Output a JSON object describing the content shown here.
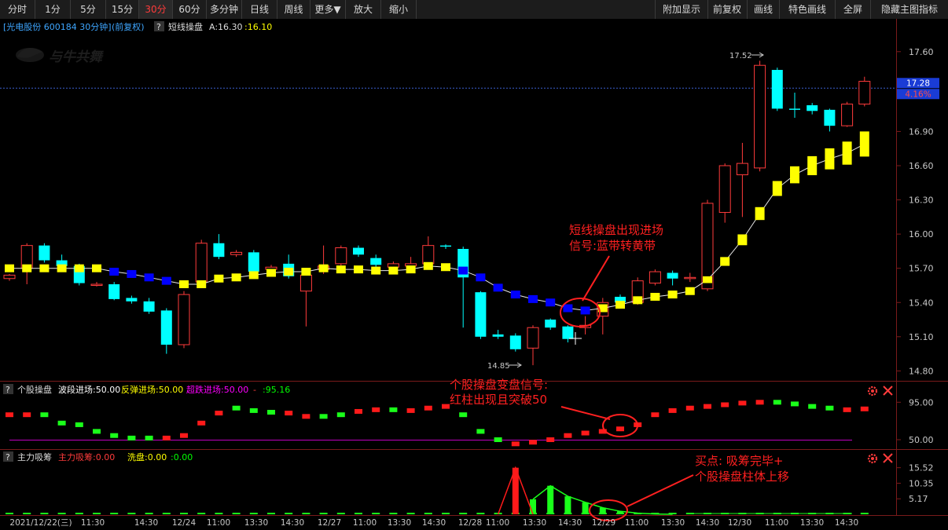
{
  "toolbar": {
    "left_buttons": [
      "分时",
      "1分",
      "5分",
      "15分",
      "30分",
      "60分",
      "多分钟",
      "日线",
      "周线",
      "更多▼",
      "放大",
      "缩小"
    ],
    "active_index": 4,
    "right_buttons": [
      "附加显示",
      "前复权",
      "画线",
      "特色画线",
      "全屏",
      "隐藏主图指标"
    ]
  },
  "main": {
    "title_stock": "[光电股份 600184 30分钟]",
    "title_fq": "(前复权)",
    "help_icon": "?",
    "indicator_name": "短线操盘",
    "indicator_a": "A:16.30",
    "indicator_b": ":16.10",
    "watermark": "与牛共舞",
    "price_ticks": [
      "17.60",
      "16.90",
      "16.60",
      "16.30",
      "16.00",
      "15.70",
      "15.40",
      "15.10",
      "14.80"
    ],
    "price_range": [
      14.72,
      17.75
    ],
    "current_price": "17.28",
    "current_pct": "4.16%",
    "high_label": "17.52",
    "low_label": "14.85",
    "annotation_line1": "短线操盘出现进场",
    "annotation_line2": "信号:蓝带转黄带"
  },
  "sub1": {
    "help_icon": "?",
    "name": "个股操盘",
    "label1": "波段进场:50.00",
    "label2": "反弹进场:50.00",
    "label3": "超跌进场:50.00",
    "label4": "-",
    "label5": ":95.16",
    "ticks": [
      "95.00",
      "50.00"
    ],
    "annotation_line1": "个股操盘变盘信号:",
    "annotation_line2": "红柱出现且突破50"
  },
  "sub2": {
    "help_icon": "?",
    "name": "主力吸筹",
    "label1": "主力吸筹:0.00",
    "label2": "洗盘:0.00",
    "label3": ":0.00",
    "ticks": [
      "15.52",
      "10.35",
      "5.17"
    ],
    "annotation_line1": "买点: 吸筹完毕+",
    "annotation_line2": "个股操盘柱体上移"
  },
  "time_axis": [
    "2021/12/22(三)",
    "11:30",
    "14:30",
    "12/24",
    "11:00",
    "13:30",
    "14:30",
    "12/27",
    "11:00",
    "13:30",
    "14:30",
    "12/28",
    "11:00",
    "13:30",
    "14:30",
    "12/29",
    "11:00",
    "13:30",
    "14:30",
    "12/30",
    "11:00",
    "13:30",
    "14:30"
  ],
  "colors": {
    "up": "#ff3b3b",
    "down": "#00ffff",
    "band_blue": "#0000ff",
    "band_yellow": "#ffff00",
    "annotation": "#ff2020",
    "accent_blue": "#1e90ff"
  },
  "chart_data": {
    "type": "candlestick",
    "candles": [
      {
        "o": 15.61,
        "c": 15.64,
        "h": 15.65,
        "l": 15.59,
        "up": true
      },
      {
        "o": 15.7,
        "c": 15.9,
        "h": 15.92,
        "l": 15.56,
        "up": true
      },
      {
        "o": 15.9,
        "c": 15.77,
        "h": 15.92,
        "l": 15.75,
        "up": false
      },
      {
        "o": 15.77,
        "c": 15.72,
        "h": 15.82,
        "l": 15.7,
        "up": false
      },
      {
        "o": 15.72,
        "c": 15.57,
        "h": 15.74,
        "l": 15.55,
        "up": false
      },
      {
        "o": 15.56,
        "c": 15.55,
        "h": 15.58,
        "l": 15.54,
        "up": true
      },
      {
        "o": 15.56,
        "c": 15.43,
        "h": 15.58,
        "l": 15.42,
        "up": false
      },
      {
        "o": 15.44,
        "c": 15.41,
        "h": 15.46,
        "l": 15.39,
        "up": false
      },
      {
        "o": 15.41,
        "c": 15.32,
        "h": 15.44,
        "l": 15.3,
        "up": false
      },
      {
        "o": 15.33,
        "c": 15.03,
        "h": 15.35,
        "l": 14.95,
        "up": false
      },
      {
        "o": 15.03,
        "c": 15.47,
        "h": 15.5,
        "l": 15.0,
        "up": true
      },
      {
        "o": 15.58,
        "c": 15.92,
        "h": 15.95,
        "l": 15.56,
        "up": true
      },
      {
        "o": 15.92,
        "c": 15.8,
        "h": 16.0,
        "l": 15.78,
        "up": false
      },
      {
        "o": 15.82,
        "c": 15.84,
        "h": 15.86,
        "l": 15.8,
        "up": true
      },
      {
        "o": 15.84,
        "c": 15.67,
        "h": 15.86,
        "l": 15.65,
        "up": false
      },
      {
        "o": 15.69,
        "c": 15.71,
        "h": 15.73,
        "l": 15.67,
        "up": true
      },
      {
        "o": 15.74,
        "c": 15.63,
        "h": 15.82,
        "l": 15.61,
        "up": false
      },
      {
        "o": 15.5,
        "c": 15.64,
        "h": 15.7,
        "l": 15.19,
        "up": true
      },
      {
        "o": 15.69,
        "c": 15.72,
        "h": 15.9,
        "l": 15.65,
        "up": true
      },
      {
        "o": 15.74,
        "c": 15.88,
        "h": 15.9,
        "l": 15.7,
        "up": true
      },
      {
        "o": 15.88,
        "c": 15.82,
        "h": 15.9,
        "l": 15.8,
        "up": false
      },
      {
        "o": 15.79,
        "c": 15.73,
        "h": 15.82,
        "l": 15.71,
        "up": false
      },
      {
        "o": 15.71,
        "c": 15.74,
        "h": 15.76,
        "l": 15.69,
        "up": true
      },
      {
        "o": 15.72,
        "c": 15.74,
        "h": 15.8,
        "l": 15.7,
        "up": true
      },
      {
        "o": 15.74,
        "c": 15.9,
        "h": 15.98,
        "l": 15.72,
        "up": true
      },
      {
        "o": 15.9,
        "c": 15.89,
        "h": 15.91,
        "l": 15.87,
        "up": false
      },
      {
        "o": 15.87,
        "c": 15.62,
        "h": 15.89,
        "l": 15.18,
        "up": false
      },
      {
        "o": 15.49,
        "c": 15.1,
        "h": 15.5,
        "l": 15.08,
        "up": false
      },
      {
        "o": 15.12,
        "c": 15.1,
        "h": 15.16,
        "l": 15.08,
        "up": false
      },
      {
        "o": 15.11,
        "c": 14.99,
        "h": 15.13,
        "l": 14.97,
        "up": false
      },
      {
        "o": 15.0,
        "c": 15.18,
        "h": 15.2,
        "l": 14.85,
        "up": true
      },
      {
        "o": 15.25,
        "c": 15.18,
        "h": 15.26,
        "l": 15.16,
        "up": false
      },
      {
        "o": 15.19,
        "c": 15.08,
        "h": 15.2,
        "l": 15.05,
        "up": false
      },
      {
        "o": 15.18,
        "c": 15.2,
        "h": 15.28,
        "l": 15.12,
        "up": true
      },
      {
        "o": 15.28,
        "c": 15.4,
        "h": 15.44,
        "l": 15.12,
        "up": true
      },
      {
        "o": 15.4,
        "c": 15.45,
        "h": 15.47,
        "l": 15.38,
        "up": false
      },
      {
        "o": 15.4,
        "c": 15.59,
        "h": 15.62,
        "l": 15.38,
        "up": true
      },
      {
        "o": 15.57,
        "c": 15.67,
        "h": 15.69,
        "l": 15.55,
        "up": true
      },
      {
        "o": 15.66,
        "c": 15.61,
        "h": 15.68,
        "l": 15.55,
        "up": false
      },
      {
        "o": 15.62,
        "c": 15.62,
        "h": 15.66,
        "l": 15.58,
        "up": true
      },
      {
        "o": 15.52,
        "c": 16.27,
        "h": 16.3,
        "l": 15.5,
        "up": true
      },
      {
        "o": 16.19,
        "c": 16.6,
        "h": 16.62,
        "l": 16.1,
        "up": true
      },
      {
        "o": 16.52,
        "c": 16.62,
        "h": 16.8,
        "l": 16.15,
        "up": true
      },
      {
        "o": 16.58,
        "c": 17.48,
        "h": 17.52,
        "l": 16.55,
        "up": true
      },
      {
        "o": 17.44,
        "c": 17.1,
        "h": 17.46,
        "l": 17.08,
        "up": false
      },
      {
        "o": 17.1,
        "c": 17.09,
        "h": 17.24,
        "l": 17.02,
        "up": false
      },
      {
        "o": 17.13,
        "c": 17.08,
        "h": 17.15,
        "l": 17.05,
        "up": false
      },
      {
        "o": 17.09,
        "c": 16.95,
        "h": 17.1,
        "l": 16.9,
        "up": false
      },
      {
        "o": 16.95,
        "c": 17.14,
        "h": 17.16,
        "l": 16.94,
        "up": true
      },
      {
        "o": 17.14,
        "c": 17.34,
        "h": 17.38,
        "l": 17.12,
        "up": true
      }
    ],
    "band": [
      15.7,
      15.7,
      15.7,
      15.7,
      15.7,
      15.7,
      15.67,
      15.65,
      15.62,
      15.59,
      15.56,
      15.56,
      15.61,
      15.62,
      15.64,
      15.66,
      15.67,
      15.67,
      15.7,
      15.69,
      15.69,
      15.68,
      15.68,
      15.69,
      15.72,
      15.71,
      15.68,
      15.62,
      15.53,
      15.47,
      15.43,
      15.4,
      15.35,
      15.33,
      15.35,
      15.38,
      15.42,
      15.45,
      15.47,
      15.5,
      15.6,
      15.76,
      15.95,
      16.18,
      16.4,
      16.52,
      16.6,
      16.66,
      16.71,
      16.79
    ],
    "band_colors": [
      "y",
      "y",
      "y",
      "y",
      "y",
      "y",
      "b",
      "b",
      "b",
      "b",
      "y",
      "y",
      "y",
      "y",
      "y",
      "y",
      "y",
      "y",
      "y",
      "y",
      "y",
      "y",
      "y",
      "y",
      "y",
      "y",
      "b",
      "b",
      "b",
      "b",
      "b",
      "b",
      "b",
      "b",
      "y",
      "y",
      "y",
      "y",
      "y",
      "y",
      "y",
      "y",
      "y",
      "y",
      "y",
      "y",
      "y",
      "y",
      "y",
      "y"
    ],
    "sub1_values": [
      80,
      80,
      80,
      70,
      68,
      60,
      55,
      52,
      52,
      52,
      55,
      70,
      82,
      88,
      85,
      83,
      82,
      78,
      78,
      80,
      84,
      86,
      86,
      85,
      88,
      90,
      80,
      60,
      50,
      45,
      47,
      50,
      55,
      58,
      60,
      63,
      68,
      80,
      85,
      88,
      90,
      92,
      94,
      95,
      95,
      93,
      90,
      88,
      86,
      87
    ],
    "sub1_colors": [
      "r",
      "r",
      "g",
      "g",
      "g",
      "g",
      "g",
      "g",
      "g",
      "r",
      "r",
      "r",
      "r",
      "g",
      "g",
      "g",
      "r",
      "r",
      "g",
      "g",
      "r",
      "r",
      "g",
      "r",
      "r",
      "r",
      "g",
      "g",
      "g",
      "r",
      "r",
      "r",
      "r",
      "r",
      "r",
      "r",
      "r",
      "r",
      "r",
      "r",
      "r",
      "r",
      "r",
      "r",
      "g",
      "g",
      "g",
      "g",
      "r",
      "r"
    ],
    "sub1_range": [
      50,
      100
    ],
    "sub2_values": [
      0,
      0,
      0,
      0,
      0,
      0,
      0,
      0,
      0,
      0,
      0,
      0,
      0,
      0,
      0,
      0,
      0,
      0,
      0,
      0,
      0,
      0,
      0,
      0,
      0,
      0,
      0,
      0,
      0,
      15.52,
      5.0,
      9.5,
      6.0,
      4.0,
      2.2,
      1.0,
      0.4,
      0.1,
      0,
      0,
      0,
      0,
      0,
      0,
      0,
      0,
      0,
      0,
      0,
      0
    ],
    "sub2_colors": [
      "g",
      "g",
      "g",
      "g",
      "g",
      "g",
      "g",
      "g",
      "g",
      "g",
      "g",
      "g",
      "g",
      "g",
      "g",
      "g",
      "g",
      "g",
      "g",
      "g",
      "g",
      "g",
      "g",
      "g",
      "g",
      "g",
      "g",
      "g",
      "g",
      "r",
      "g",
      "g",
      "g",
      "g",
      "g",
      "g",
      "g",
      "g",
      "g",
      "g",
      "g",
      "g",
      "g",
      "g",
      "g",
      "g",
      "g",
      "g",
      "g",
      "g"
    ],
    "sub2_range": [
      0,
      17
    ]
  }
}
